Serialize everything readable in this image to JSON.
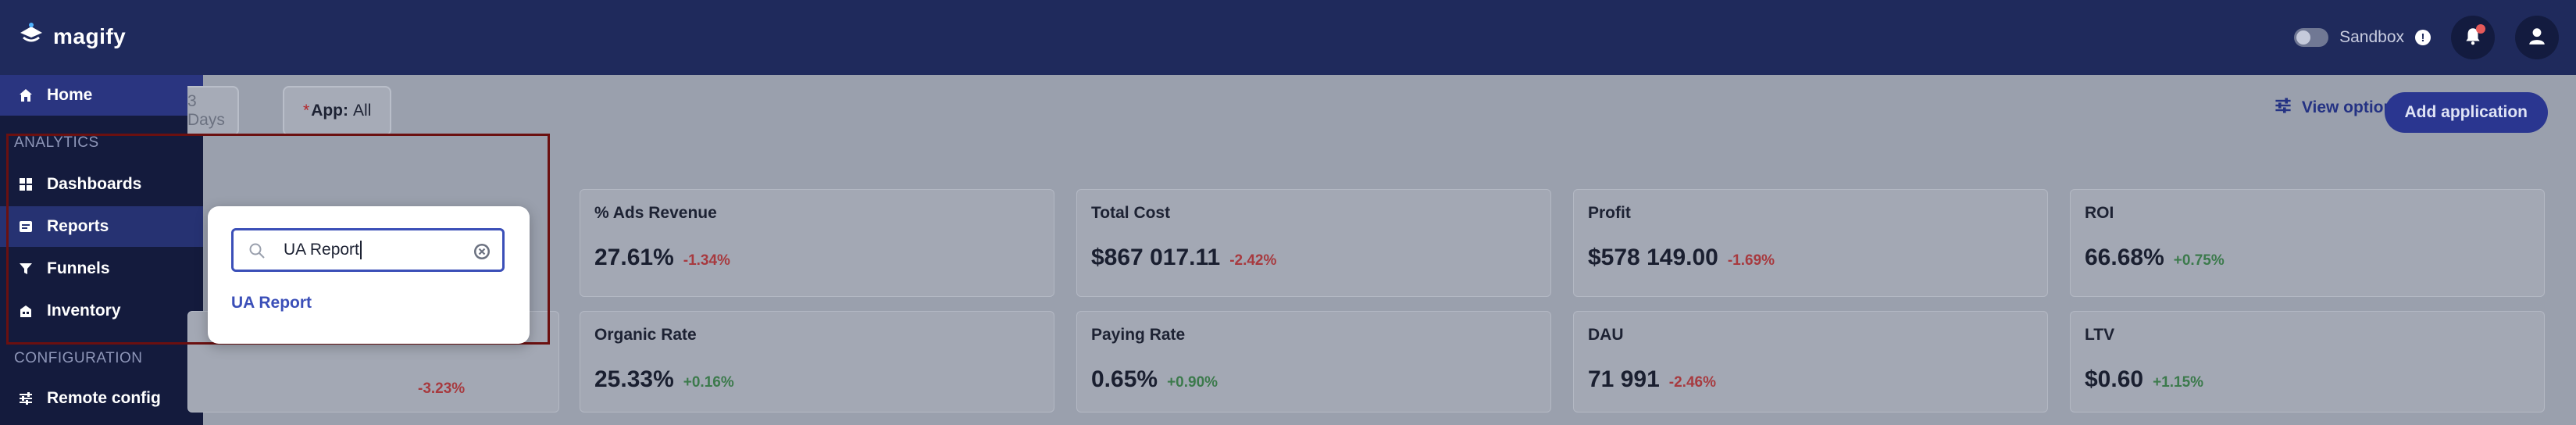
{
  "app": {
    "brand": "magify"
  },
  "topbar": {
    "sandbox_label": "Sandbox",
    "info_glyph": "!",
    "icons": [
      "bell-icon",
      "user-icon"
    ]
  },
  "sidebar": {
    "home": "Home",
    "section_analytics": "ANALYTICS",
    "dashboards": "Dashboards",
    "reports": "Reports",
    "funnels": "Funnels",
    "inventory": "Inventory",
    "section_configuration": "CONFIGURATION",
    "remote_config": "Remote config"
  },
  "filters": {
    "date_partial": "3 Days",
    "app_required_mark": "*",
    "app_label": "App:",
    "app_value": "All"
  },
  "toolbar": {
    "view_options": "View options",
    "add_application": "Add application"
  },
  "metrics_row1": [
    {
      "title": "% Ads Revenue",
      "value": "27.61%",
      "delta": "-1.34%",
      "trend": "neg"
    },
    {
      "title": "Total Cost",
      "value": "$867 017.11",
      "delta": "-2.42%",
      "trend": "neg"
    },
    {
      "title": "Profit",
      "value": "$578 149.00",
      "delta": "-1.69%",
      "trend": "neg"
    },
    {
      "title": "ROI",
      "value": "66.68%",
      "delta": "+0.75%",
      "trend": "pos"
    }
  ],
  "metrics_row2": [
    {
      "title": "",
      "value": "",
      "delta": "-3.23%",
      "trend": "neg"
    },
    {
      "title": "Organic Rate",
      "value": "25.33%",
      "delta": "+0.16%",
      "trend": "pos"
    },
    {
      "title": "Paying Rate",
      "value": "0.65%",
      "delta": "+0.90%",
      "trend": "pos"
    },
    {
      "title": "DAU",
      "value": "71 991",
      "delta": "-2.46%",
      "trend": "neg"
    },
    {
      "title": "LTV",
      "value": "$0.60",
      "delta": "+1.15%",
      "trend": "pos"
    }
  ],
  "search_popup": {
    "query": "UA Report",
    "results": [
      "UA Report"
    ]
  },
  "colors": {
    "topbar": "#1f2a5c",
    "sidebar": "#141b3d",
    "accent": "#3b4fb8",
    "highlight_border": "#6b1010",
    "negative": "#a73a3f",
    "positive": "#3c7a4c"
  }
}
